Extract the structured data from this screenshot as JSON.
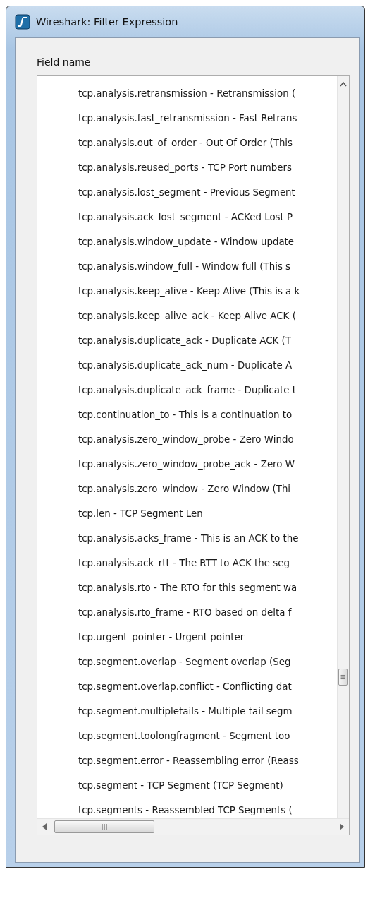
{
  "window": {
    "title": "Wireshark: Filter Expression"
  },
  "field_name": {
    "label": "Field name",
    "items": [
      {
        "text": "tcp.analysis.retransmission - Retransmission ("
      },
      {
        "text": "tcp.analysis.fast_retransmission - Fast Retrans"
      },
      {
        "text": "tcp.analysis.out_of_order - Out Of Order (This"
      },
      {
        "text": "tcp.analysis.reused_ports - TCP Port numbers"
      },
      {
        "text": "tcp.analysis.lost_segment - Previous Segment"
      },
      {
        "text": "tcp.analysis.ack_lost_segment - ACKed Lost P"
      },
      {
        "text": "tcp.analysis.window_update - Window update"
      },
      {
        "text": "tcp.analysis.window_full - Window full (This s"
      },
      {
        "text": "tcp.analysis.keep_alive - Keep Alive (This is a k"
      },
      {
        "text": "tcp.analysis.keep_alive_ack - Keep Alive ACK ("
      },
      {
        "text": "tcp.analysis.duplicate_ack - Duplicate ACK (T"
      },
      {
        "text": "tcp.analysis.duplicate_ack_num - Duplicate A"
      },
      {
        "text": "tcp.analysis.duplicate_ack_frame - Duplicate t"
      },
      {
        "text": "tcp.continuation_to - This is a continuation to"
      },
      {
        "text": "tcp.analysis.zero_window_probe - Zero Windo"
      },
      {
        "text": "tcp.analysis.zero_window_probe_ack - Zero W"
      },
      {
        "text": "tcp.analysis.zero_window - Zero Window (Thi"
      },
      {
        "text": "tcp.len - TCP Segment Len"
      },
      {
        "text": "tcp.analysis.acks_frame - This is an ACK to the"
      },
      {
        "text": "tcp.analysis.ack_rtt - The RTT to ACK the seg"
      },
      {
        "text": "tcp.analysis.rto - The RTO for this segment wa"
      },
      {
        "text": "tcp.analysis.rto_frame - RTO based on delta f"
      },
      {
        "text": "tcp.urgent_pointer - Urgent pointer"
      },
      {
        "text": "tcp.segment.overlap - Segment overlap (Seg"
      },
      {
        "text": "tcp.segment.overlap.conflict - Conflicting dat"
      },
      {
        "text": "tcp.segment.multipletails - Multiple tail segm"
      },
      {
        "text": "tcp.segment.toolongfragment - Segment too"
      },
      {
        "text": "tcp.segment.error - Reassembling error (Reass"
      },
      {
        "text": "tcp.segment - TCP Segment (TCP Segment)"
      },
      {
        "text": "tcp.segments - Reassembled TCP Segments ("
      }
    ]
  }
}
